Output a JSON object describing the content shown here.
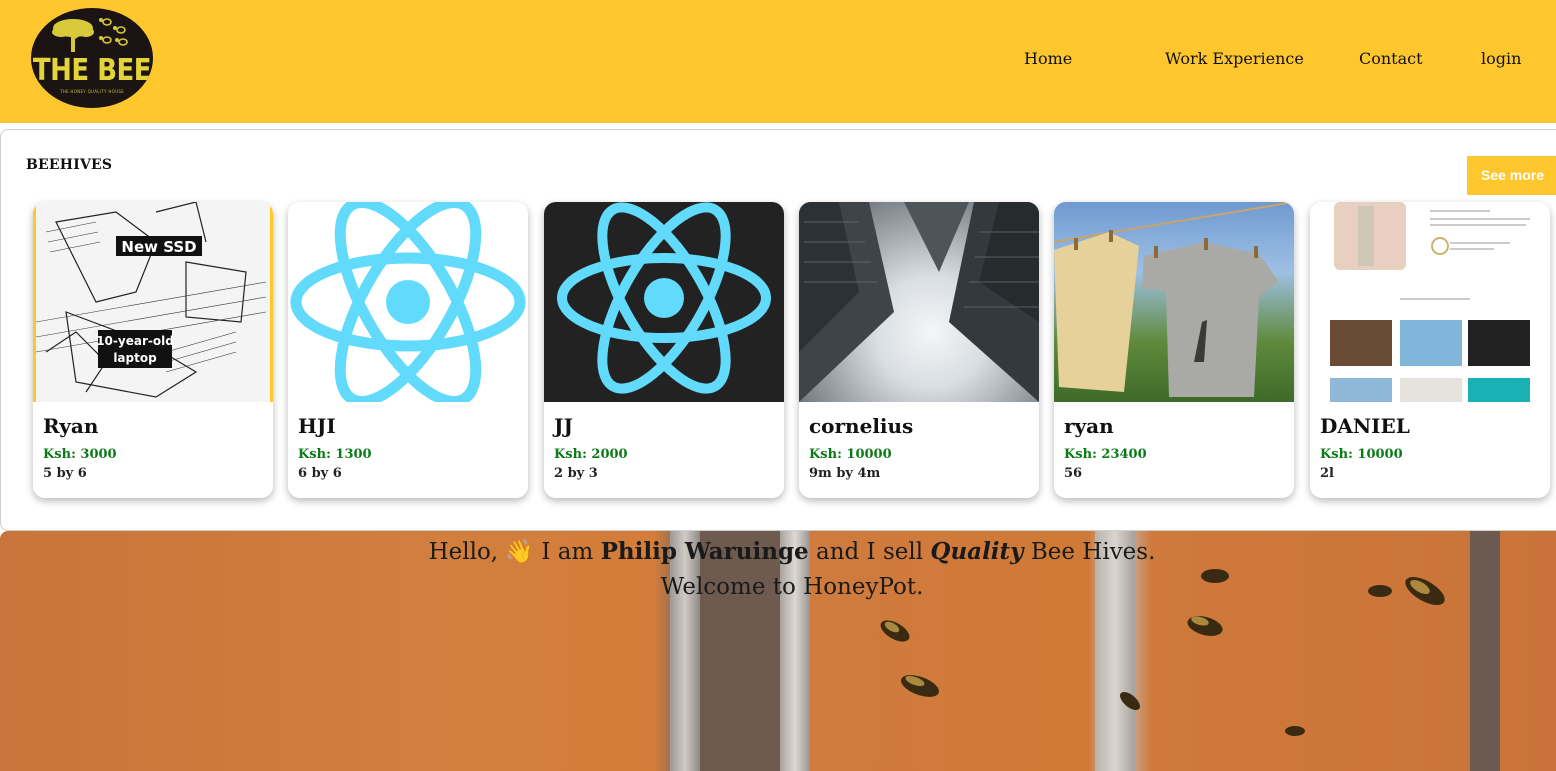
{
  "header": {
    "logo": {
      "title": "THE BEE",
      "tagline": "THE HONEY QUALITY HOUSE"
    },
    "nav": [
      {
        "label": "Home"
      },
      {
        "label": "Work Experience"
      },
      {
        "label": "Contact"
      },
      {
        "label": "login"
      }
    ],
    "brand_color": "#fec72e"
  },
  "beehives": {
    "title": "BEEHIVES",
    "see_more_label": "See more",
    "cards": [
      {
        "name": "Ryan",
        "price": "Ksh: 3000",
        "size": "5 by 6",
        "image": "comic-new-ssd",
        "image_text": [
          "New SSD",
          "10-year-old laptop"
        ]
      },
      {
        "name": "HJI",
        "price": "Ksh: 1300",
        "size": "6 by 6",
        "image": "react-logo-white"
      },
      {
        "name": "JJ",
        "price": "Ksh: 2000",
        "size": "2 by 3",
        "image": "react-logo-dark"
      },
      {
        "name": "cornelius",
        "price": "Ksh: 10000",
        "size": "9m by 4m",
        "image": "skyscrapers-photo"
      },
      {
        "name": "ryan",
        "price": "Ksh: 23400",
        "size": "56",
        "image": "clothesline-photo"
      },
      {
        "name": "DANIEL",
        "price": "Ksh: 10000",
        "size": "2l",
        "image": "portfolio-screenshot"
      }
    ],
    "price_color": "#0b7a16"
  },
  "hero": {
    "hello": "Hello,",
    "wave": "👋",
    "i_am": "I am",
    "name": "Philip Waruinge",
    "and_sell": "and I sell",
    "quality": "Quality",
    "product": "Bee Hives.",
    "welcome": "Welcome to HoneyPot.",
    "background": "beehive-photo"
  }
}
